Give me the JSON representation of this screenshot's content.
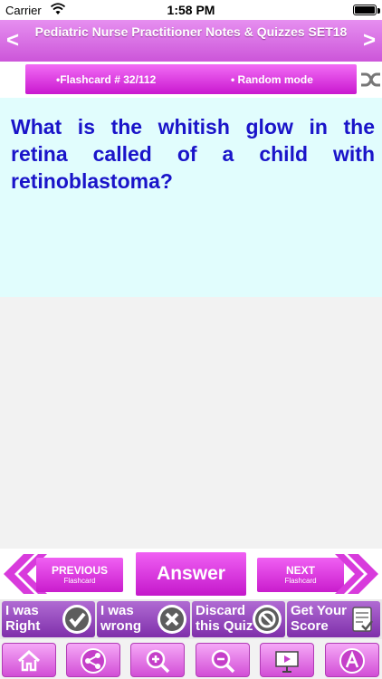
{
  "status_bar": {
    "carrier": "Carrier",
    "time": "1:58 PM"
  },
  "header": {
    "title": "Pediatric Nurse Practitioner Notes & Quizzes SET18"
  },
  "flashcard_bar": {
    "counter": "•Flashcard # 32/112",
    "mode": "• Random mode"
  },
  "question": {
    "text": "What is the whitish glow in the retina called of a child with retinoblastoma?"
  },
  "nav": {
    "previous_label": "PREVIOUS",
    "previous_sub": "Flashcard",
    "answer_label": "Answer",
    "next_label": "NEXT",
    "next_sub": "Flashcard"
  },
  "actions": [
    {
      "line1": "I was",
      "line2": "Right",
      "icon": "checkmark-icon"
    },
    {
      "line1": "I was",
      "line2": "wrong",
      "icon": "x-icon"
    },
    {
      "line1": "Discard",
      "line2": "this Quiz",
      "icon": "prohibited-icon"
    },
    {
      "line1": "Get Your",
      "line2": "Score",
      "icon": "score-sheet-icon"
    }
  ],
  "toolbar_icons": [
    "home-icon",
    "share-icon",
    "zoom-in-icon",
    "zoom-out-icon",
    "slideshow-icon",
    "font-icon"
  ],
  "colors": {
    "accent_magenta": "#cc44d4",
    "question_text": "#1a14c9",
    "question_bg": "#e1fdfd",
    "action_purple": "#9b4cc4"
  }
}
